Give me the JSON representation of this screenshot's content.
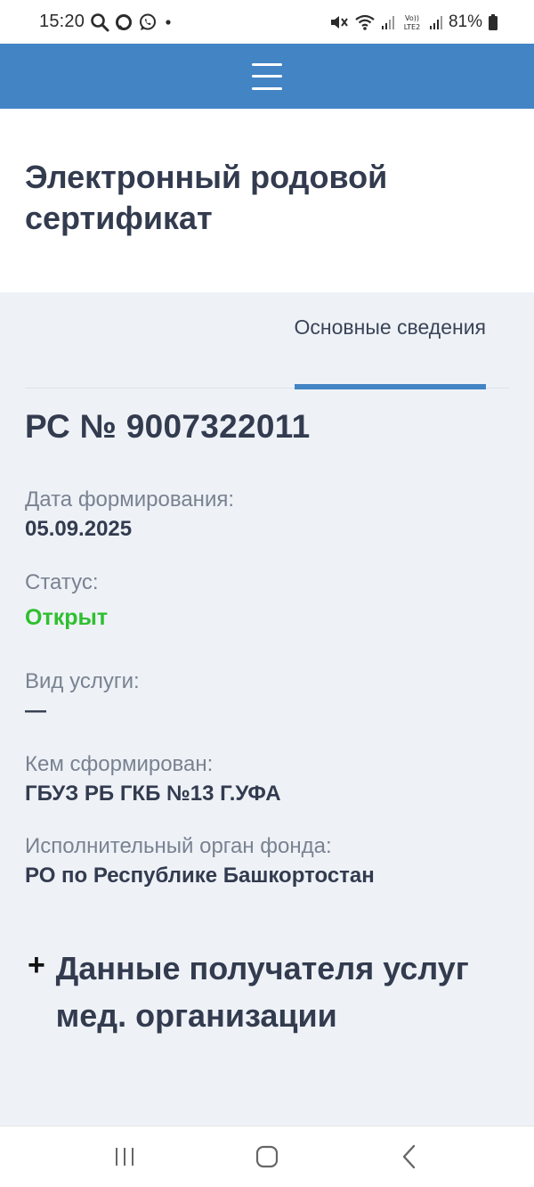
{
  "status_bar": {
    "time": "15:20",
    "battery": "81%",
    "icons": [
      "search-icon",
      "chat-icon",
      "whatsapp-icon",
      "dot-icon",
      "mute-icon",
      "wifi-icon",
      "signal-icon",
      "volte-icon",
      "signal-icon",
      "battery-icon"
    ],
    "volte_top": "Vo))",
    "volte_bottom": "LTE2"
  },
  "header": {
    "menu_icon": "hamburger-menu-icon",
    "color": "#4384c5"
  },
  "page": {
    "title": "Электронный родовой сертификат"
  },
  "tabs": [
    {
      "label": "Основные сведения",
      "active": true
    }
  ],
  "certificate": {
    "number": "РС № 9007322011",
    "fields": {
      "date": {
        "label": "Дата формирования:",
        "value": "05.09.2025"
      },
      "status": {
        "label": "Статус:",
        "value": "Открыт",
        "color": "#2fbf2f"
      },
      "service": {
        "label": "Вид услуги:",
        "value": "—"
      },
      "created_by": {
        "label": "Кем сформирован:",
        "value": "ГБУЗ РБ ГКБ №13 Г.УФА"
      },
      "fund": {
        "label": "Исполнительный орган фонда:",
        "value": "РО по Республике Башкортостан"
      }
    }
  },
  "expand": {
    "icon": "+",
    "title": "Данные получателя услуг мед. организации"
  },
  "nav_bar": {
    "icons": [
      "recent-apps-icon",
      "home-icon",
      "back-icon"
    ]
  }
}
